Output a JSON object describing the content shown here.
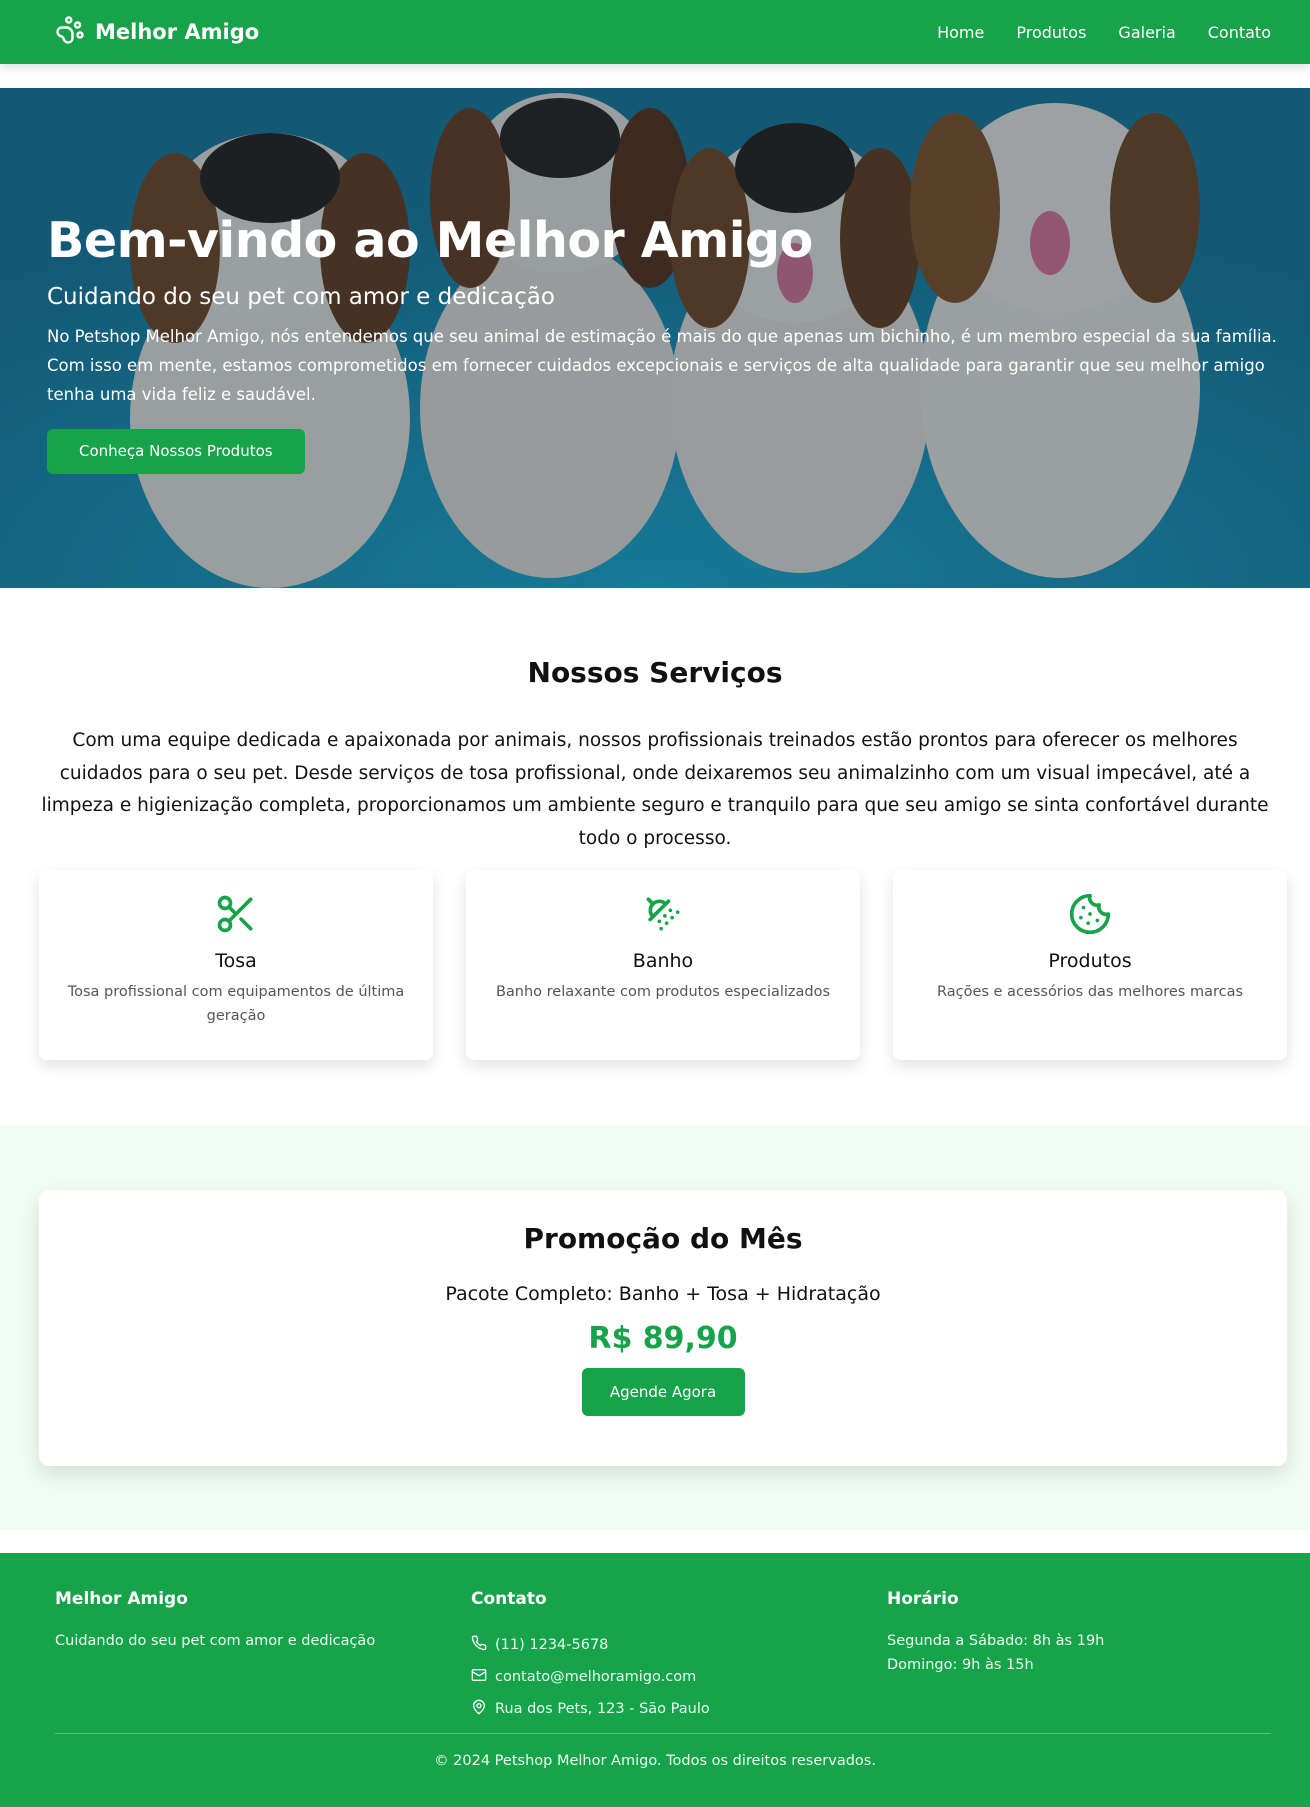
{
  "nav": {
    "brand": "Melhor Amigo",
    "links": [
      "Home",
      "Produtos",
      "Galeria",
      "Contato"
    ]
  },
  "hero": {
    "title": "Bem-vindo ao Melhor Amigo",
    "subtitle": "Cuidando do seu pet com amor e dedicação",
    "text": "No Petshop Melhor Amigo, nós entendemos que seu animal de estimação é mais do que apenas um bichinho, é um membro especial da sua família. Com isso em mente, estamos comprometidos em fornecer cuidados excepcionais e serviços de alta qualidade para garantir que seu melhor amigo tenha uma vida feliz e saudável.",
    "button": "Conheça Nossos Produtos"
  },
  "services": {
    "title": "Nossos Serviços",
    "text": "Com uma equipe dedicada e apaixonada por animais, nossos profissionais treinados estão prontos para oferecer os melhores cuidados para o seu pet. Desde serviços de tosa profissional, onde deixaremos seu animalzinho com um visual impecável, até a limpeza e higienização completa, proporcionamos um ambiente seguro e tranquilo para que seu amigo se sinta confortável durante todo o processo.",
    "cards": [
      {
        "icon": "scissors-icon",
        "title": "Tosa",
        "desc": "Tosa profissional com equipamentos de última geração"
      },
      {
        "icon": "shower-icon",
        "title": "Banho",
        "desc": "Banho relaxante com produtos especializados"
      },
      {
        "icon": "cookie-icon",
        "title": "Produtos",
        "desc": "Rações e acessórios das melhores marcas"
      }
    ]
  },
  "promo": {
    "title": "Promoção do Mês",
    "package": "Pacote Completo: Banho + Tosa + Hidratação",
    "price": "R$ 89,90",
    "button": "Agende Agora"
  },
  "footer": {
    "about_title": "Melhor Amigo",
    "about_text": "Cuidando do seu pet com amor e dedicação",
    "contact_title": "Contato",
    "phone": "(11) 1234-5678",
    "email": "contato@melhoramigo.com",
    "address": "Rua dos Pets, 123 - São Paulo",
    "hours_title": "Horário",
    "hours_weekdays": "Segunda a Sábado: 8h às 19h",
    "hours_sunday": "Domingo: 9h às 15h",
    "copyright": "© 2024 Petshop Melhor Amigo. Todos os direitos reservados."
  },
  "colors": {
    "primary": "#16a34a",
    "promo_bg": "#f0fdf4",
    "hero_bg": "#1d8bb0"
  }
}
